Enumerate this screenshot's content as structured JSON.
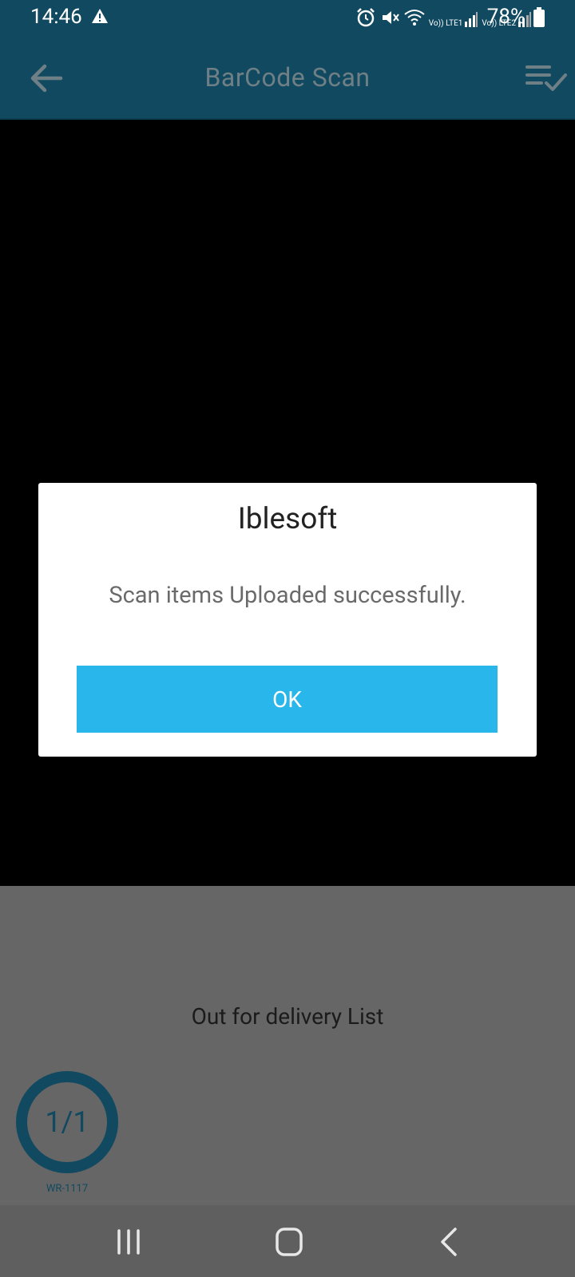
{
  "status_bar": {
    "time": "14:46",
    "battery": "78%",
    "network_labels": [
      "Vo)) LTE1",
      "Vo)) LTE2"
    ]
  },
  "app_bar": {
    "title": "BarCode Scan",
    "icons": [
      "arrow-left-icon",
      "list-check-icon"
    ]
  },
  "dialog": {
    "title": "Iblesoft",
    "message": "Scan items Uploaded successfully.",
    "ok_label": "OK"
  },
  "delivery": {
    "heading": "Out for delivery List",
    "progress_text": "1/1",
    "progress_fraction": 1.0,
    "route_id": "WR-1117"
  },
  "colors": {
    "primary": "#114a60",
    "accent_button": "#29b6ea",
    "panel_gray": "#666666"
  },
  "nav_bar": {
    "icons": [
      "recent-apps-icon",
      "home-icon",
      "back-icon"
    ]
  }
}
